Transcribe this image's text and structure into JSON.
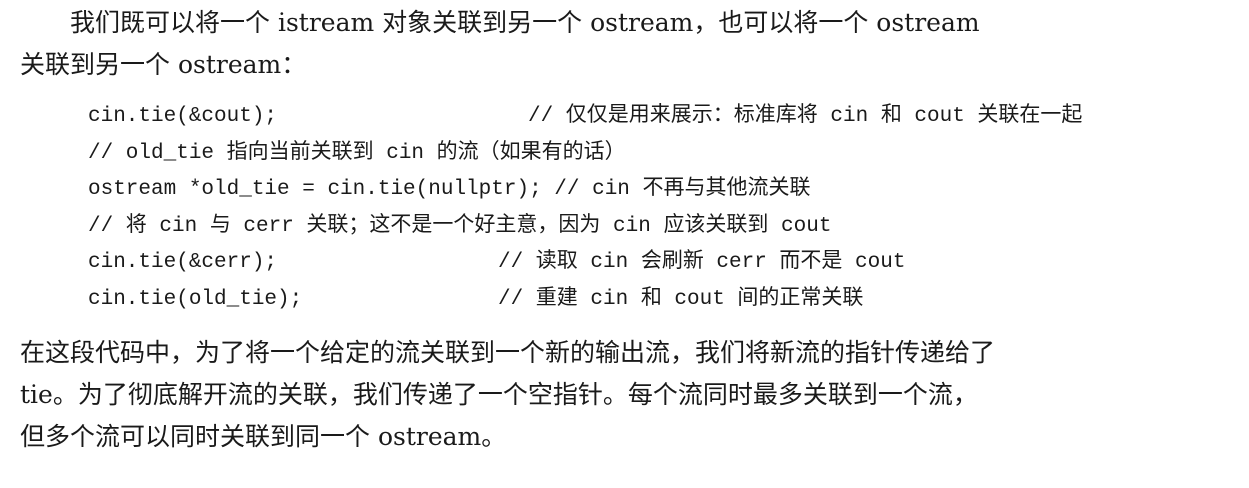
{
  "paragraph_1": {
    "line_1": "我们既可以将一个 istream 对象关联到另一个 ostream，也可以将一个 ostream",
    "line_2": "关联到另一个 ostream："
  },
  "code": [
    {
      "code": "cin.tie(&cout);",
      "comment": "// 仅仅是用来展示：标准库将 cin 和 cout 关联在一起"
    },
    {
      "code": "",
      "comment": "// old_tie 指向当前关联到 cin 的流（如果有的话）"
    },
    {
      "code": "ostream *old_tie = cin.tie(nullptr);",
      "comment": "// cin 不再与其他流关联"
    },
    {
      "code": "",
      "comment": "// 将 cin 与 cerr 关联；这不是一个好主意，因为 cin 应该关联到 cout"
    },
    {
      "code": "cin.tie(&cerr);",
      "comment": "// 读取 cin 会刷新 cerr 而不是 cout"
    },
    {
      "code": "cin.tie(old_tie);",
      "comment": "// 重建 cin 和 cout 间的正常关联"
    }
  ],
  "paragraph_2": {
    "line_1": "在这段代码中，为了将一个给定的流关联到一个新的输出流，我们将新流的指针传递给了",
    "line_2": "tie。为了彻底解开流的关联，我们传递了一个空指针。每个流同时最多关联到一个流，",
    "line_3": "但多个流可以同时关联到同一个 ostream。"
  }
}
